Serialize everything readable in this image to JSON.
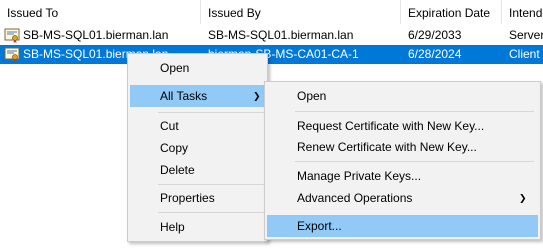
{
  "columns": [
    "Issued To",
    "Issued By",
    "Expiration Date",
    "Intende"
  ],
  "rows": [
    {
      "issued_to": "SB-MS-SQL01.bierman.lan",
      "issued_by": "SB-MS-SQL01.bierman.lan",
      "expiration": "6/29/2033",
      "intended": "Server",
      "icon": "certificate-icon",
      "selected": false
    },
    {
      "issued_to": "SB-MS-SQL01.bierman.lan",
      "issued_by": "bierman-SB-MS-CA01-CA-1",
      "expiration": "6/28/2024",
      "intended": "Client",
      "icon": "certificate-icon",
      "selected": true
    }
  ],
  "context_menu": {
    "open": "Open",
    "all_tasks": "All Tasks",
    "cut": "Cut",
    "copy": "Copy",
    "delete": "Delete",
    "properties": "Properties",
    "help": "Help",
    "submenu_arrow": "❯"
  },
  "submenu": {
    "open": "Open",
    "request_new_key": "Request Certificate with New Key...",
    "renew_new_key": "Renew Certificate with New Key...",
    "manage_private_keys": "Manage Private Keys...",
    "advanced_operations": "Advanced Operations",
    "export": "Export...",
    "submenu_arrow": "❯"
  },
  "colors": {
    "selection": "#0078d7",
    "menu_highlight": "#91c9f7",
    "menu_background": "#f2f2f2"
  }
}
